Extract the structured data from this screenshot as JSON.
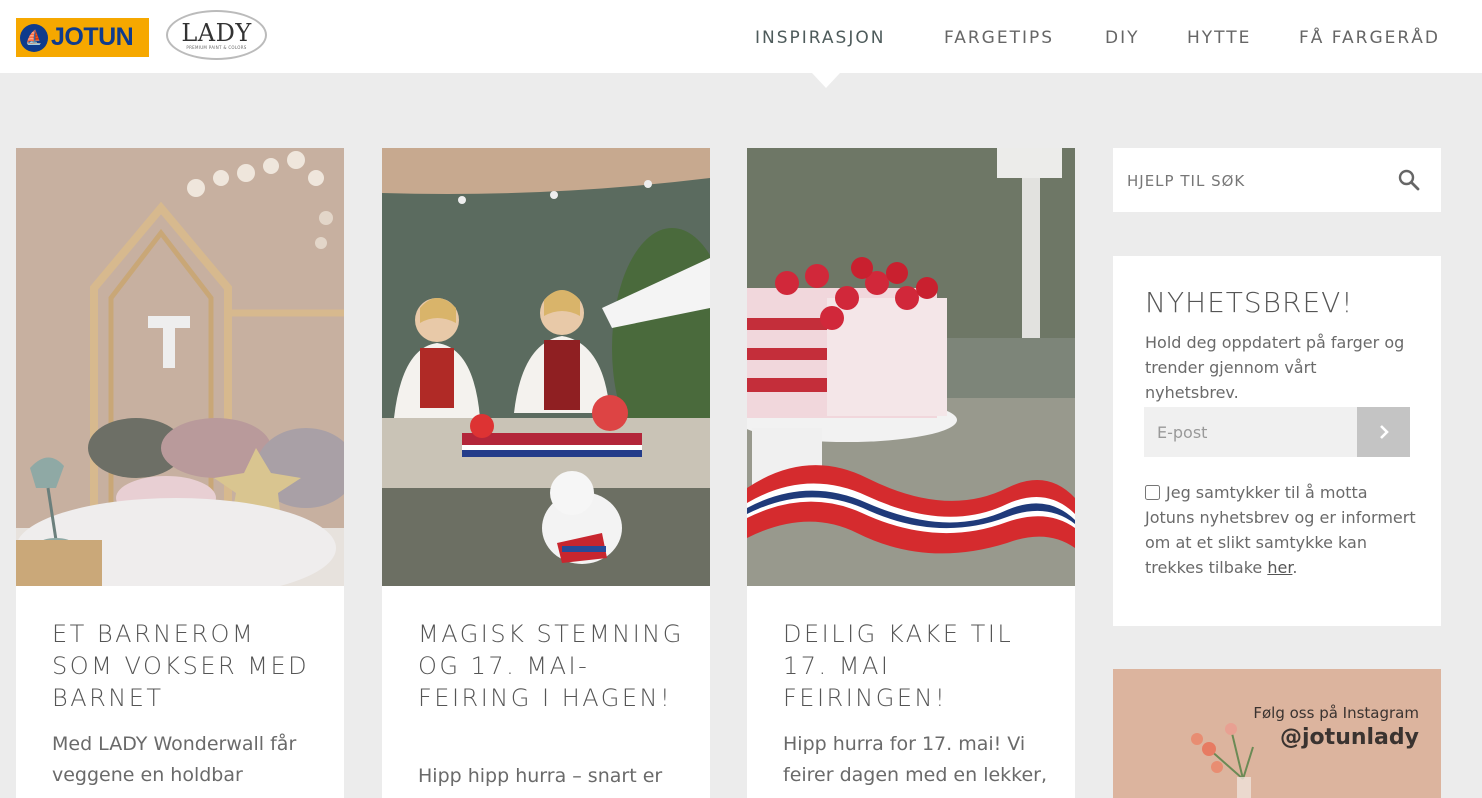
{
  "header": {
    "logo_jotun": "JOTUN",
    "logo_lady": "LADY",
    "logo_lady_sub": "PREMIUM PAINT & COLORS",
    "nav": [
      {
        "label": "INSPIRASJON",
        "active": true
      },
      {
        "label": "FARGETIPS",
        "active": false
      },
      {
        "label": "DIY",
        "active": false
      },
      {
        "label": "HYTTE",
        "active": false
      },
      {
        "label": "FÅ FARGERÅD",
        "active": false
      }
    ]
  },
  "cards": [
    {
      "image_icon": "kids-bedroom-photo",
      "title": "ET BARNEROM SOM VOKSER MED BARNET",
      "excerpt": "Med LADY Wonderwall får veggene en holdbar"
    },
    {
      "image_icon": "garden-party-photo",
      "title": "MAGISK STEMNING OG 17. MAI-FEIRING I HAGEN!",
      "excerpt": "Hipp hipp hurra – snart er"
    },
    {
      "image_icon": "cake-photo",
      "title": "DEILIG KAKE TIL 17. MAI FEIRINGEN!",
      "excerpt": "Hipp hurra for 17. mai! Vi feirer dagen med en lekker,"
    }
  ],
  "search": {
    "placeholder": "HJELP TIL SØK"
  },
  "newsletter": {
    "title": "NYHETSBREV!",
    "description": "Hold deg oppdatert på farger og trender gjennom vårt nyhetsbrev.",
    "email_placeholder": "E-post",
    "consent_text": "Jeg samtykker til å motta Jotuns nyhetsbrev og er informert om at et slikt samtykke kan trekkes tilbake ",
    "consent_link": "her",
    "consent_end": "."
  },
  "instagram": {
    "follow_text": "Følg oss på Instagram",
    "handle": "@jotunlady"
  },
  "colors": {
    "background": "#ececec",
    "jotun_yellow": "#f6a800",
    "jotun_blue": "#0f3b8c",
    "text": "#555555",
    "submit_button": "#c4c4c4",
    "instagram_bg": "#dcb49e"
  }
}
